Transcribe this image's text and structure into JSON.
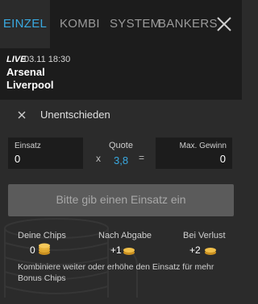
{
  "tabs": [
    {
      "label": "EINZEL",
      "active": true
    },
    {
      "label": "KOMBI",
      "active": false
    },
    {
      "label": "SYSTEM",
      "active": false
    },
    {
      "label": "BANKERS",
      "active": false
    }
  ],
  "match": {
    "live_label": "LIVE",
    "datetime": "03.11 18:30",
    "team1": "Arsenal",
    "team2": "Liverpool"
  },
  "selection": {
    "label": "Unentschieden"
  },
  "stake": {
    "einsatz_label": "Einsatz",
    "einsatz_value": "0",
    "multiply_sign": "x",
    "quote_label": "Quote",
    "quote_value": "3,8",
    "equals_sign": "=",
    "gain_label": "Max. Gewinn",
    "gain_value": "0"
  },
  "submit": {
    "label": "Bitte gib einen Einsatz ein"
  },
  "bonus": {
    "chips_label": "Deine Chips",
    "chips_value": "0",
    "after_label": "Nach Abgabe",
    "after_value": "+1",
    "loss_label": "Bei Verlust",
    "loss_value": "+2",
    "hint": "Kombiniere weiter oder erhöhe den Einsatz für mehr Bonus Chips"
  },
  "colors": {
    "accent": "#39a9e0",
    "coin": "#e8b23a"
  }
}
